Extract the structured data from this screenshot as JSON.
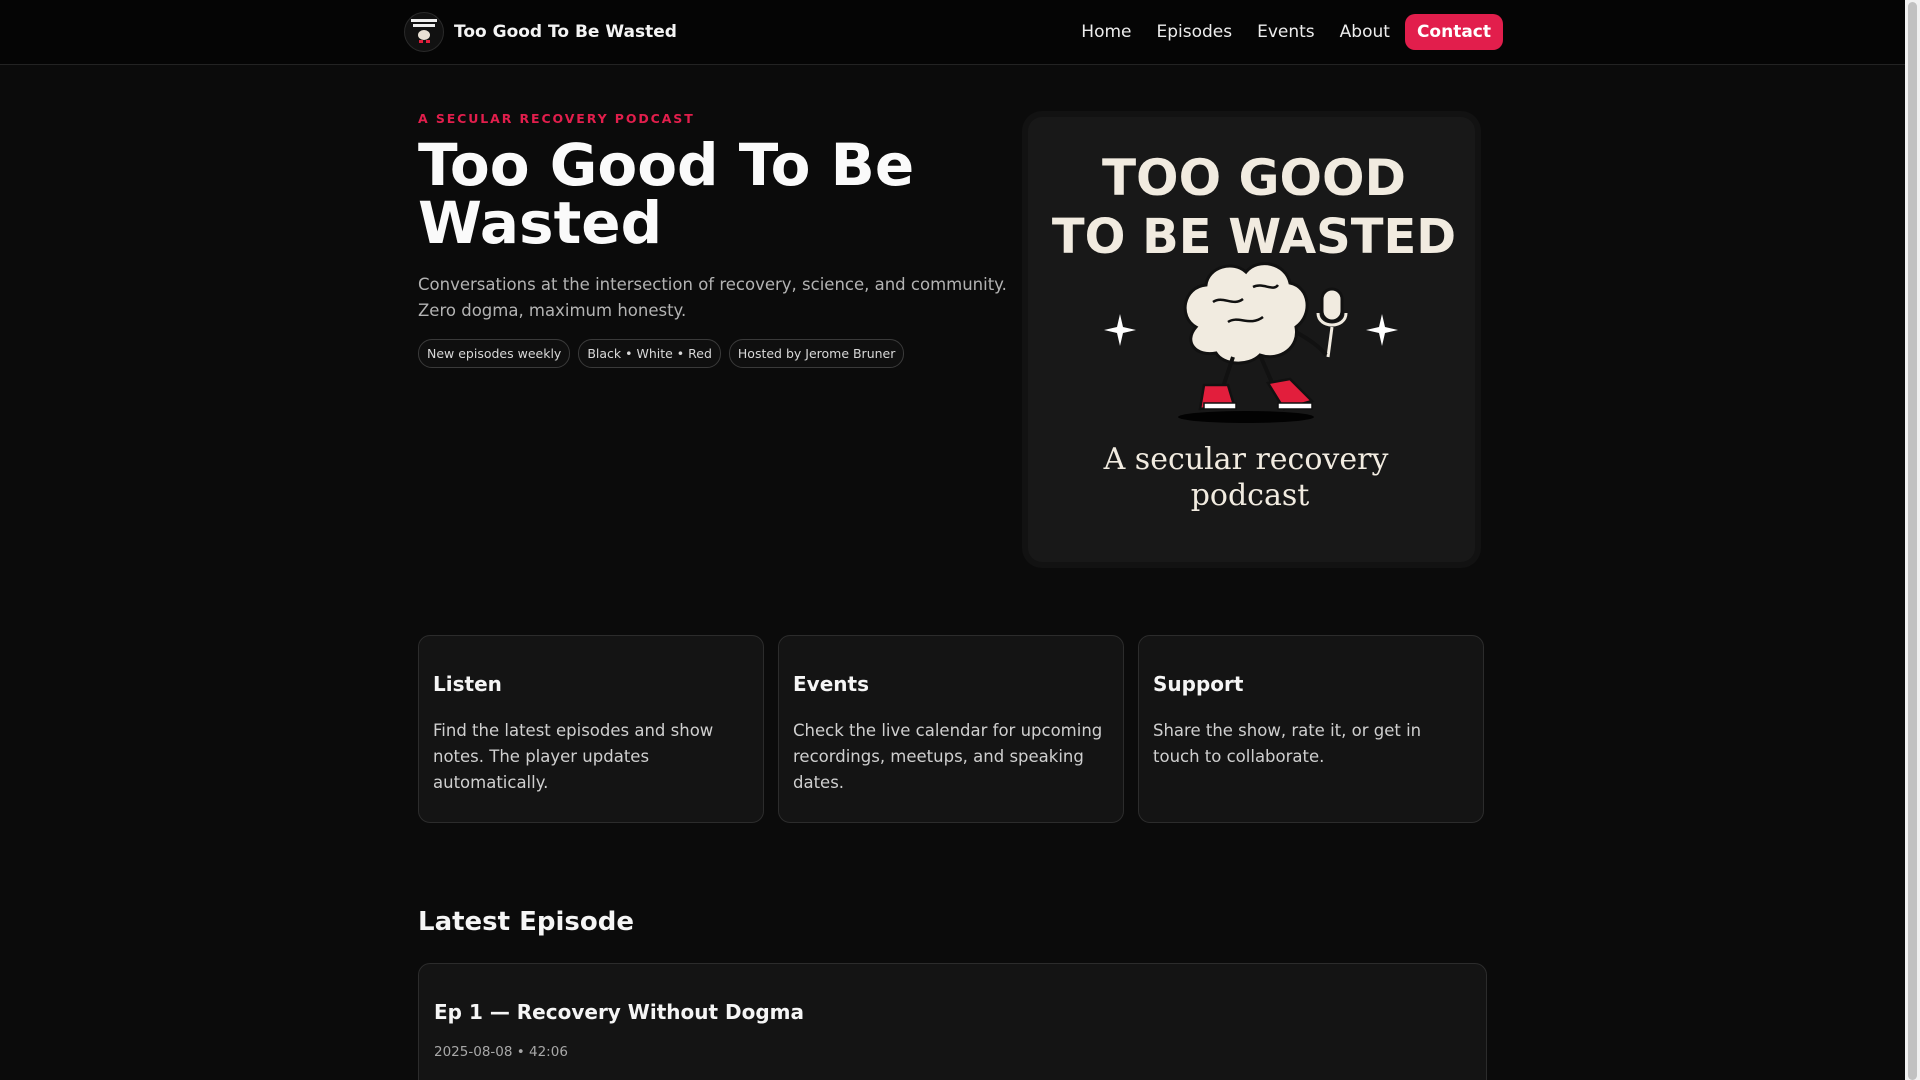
{
  "nav": {
    "brand": "Too Good To Be Wasted",
    "links": [
      "Home",
      "Episodes",
      "Events",
      "About"
    ],
    "cta": "Contact"
  },
  "hero": {
    "eyebrow": "A SECULAR RECOVERY PODCAST",
    "title": "Too Good To Be Wasted",
    "description": "Conversations at the intersection of recovery, science, and community. Zero dogma, maximum honesty.",
    "pills": [
      "New episodes weekly",
      "Black • White • Red",
      "Hosted by Jerome Bruner"
    ]
  },
  "artwork": {
    "line1": "TOO GOOD",
    "line2": "TO BE WASTED",
    "tagline1": "A secular recovery",
    "tagline2": "podcast"
  },
  "cards": [
    {
      "title": "Listen",
      "body": "Find the latest episodes and show notes. The player updates automatically."
    },
    {
      "title": "Events",
      "body": "Check the live calendar for upcoming recordings, meetups, and speaking dates."
    },
    {
      "title": "Support",
      "body": "Share the show, rate it, or get in touch to collaborate."
    }
  ],
  "latest": {
    "heading": "Latest Episode",
    "episode_title": "Ep 1 — Recovery Without Dogma",
    "episode_meta": "2025-08-08 • 42:06"
  },
  "colors": {
    "background": "#0b0b0b",
    "accent": "#e21e4c",
    "text": "#f2f2f2"
  }
}
